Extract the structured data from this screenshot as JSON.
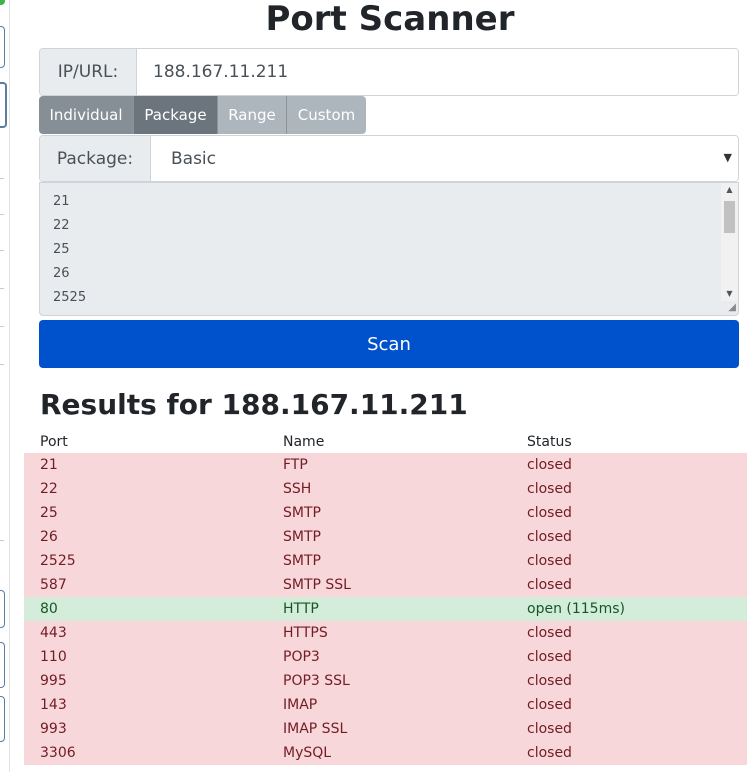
{
  "title": "Port Scanner",
  "target": {
    "label": "IP/URL:",
    "value": "188.167.11.211"
  },
  "tabs": [
    {
      "label": "Individual",
      "active": false
    },
    {
      "label": "Package",
      "active": true
    },
    {
      "label": "Range",
      "active": false
    },
    {
      "label": "Custom",
      "active": false
    }
  ],
  "package": {
    "label": "Package:",
    "value": "Basic"
  },
  "ports_textarea": [
    "21",
    "22",
    "25",
    "26",
    "2525"
  ],
  "scan_button": "Scan",
  "results": {
    "title": "Results for 188.167.11.211",
    "headers": {
      "port": "Port",
      "name": "Name",
      "status": "Status"
    },
    "rows": [
      {
        "port": "21",
        "name": "FTP",
        "status": "closed"
      },
      {
        "port": "22",
        "name": "SSH",
        "status": "closed"
      },
      {
        "port": "25",
        "name": "SMTP",
        "status": "closed"
      },
      {
        "port": "26",
        "name": "SMTP",
        "status": "closed"
      },
      {
        "port": "2525",
        "name": "SMTP",
        "status": "closed"
      },
      {
        "port": "587",
        "name": "SMTP SSL",
        "status": "closed"
      },
      {
        "port": "80",
        "name": "HTTP",
        "status": "open (115ms)"
      },
      {
        "port": "443",
        "name": "HTTPS",
        "status": "closed"
      },
      {
        "port": "110",
        "name": "POP3",
        "status": "closed"
      },
      {
        "port": "995",
        "name": "POP3 SSL",
        "status": "closed"
      },
      {
        "port": "143",
        "name": "IMAP",
        "status": "closed"
      },
      {
        "port": "993",
        "name": "IMAP SSL",
        "status": "closed"
      },
      {
        "port": "3306",
        "name": "MySQL",
        "status": "closed"
      }
    ]
  },
  "colors": {
    "primary": "#0052cc",
    "closed_bg": "#f8d7da",
    "closed_text": "#721c24",
    "open_bg": "#d4edda",
    "open_text": "#155724"
  }
}
